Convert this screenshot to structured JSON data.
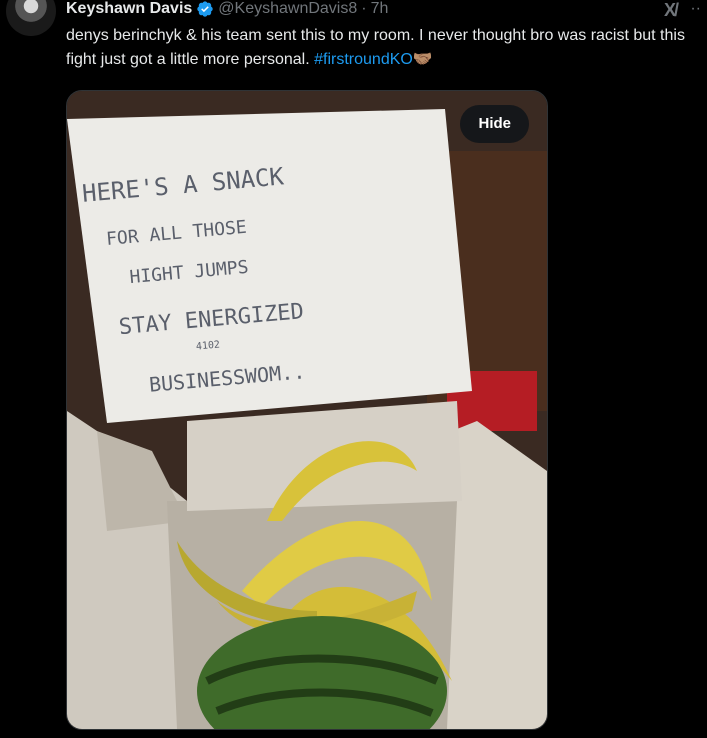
{
  "tweet": {
    "author_name": "Keyshawn Davis",
    "handle": "@KeyshawnDavis8",
    "separator": "·",
    "time": "7h",
    "text_main": "denys berinchyk & his team sent this to my room. I never thought bro was racist but this fight just got a little more personal. ",
    "hashtag": "#firstroundKO",
    "emoji": "🤝🏽"
  },
  "media": {
    "hide_label": "Hide",
    "note_lines": [
      "HERE'S A SNACK",
      "FOR ALL THOSE",
      "HIGHT JUMPS",
      "STAY ENERGIZED",
      "4102",
      "BUSINESSWOM.."
    ]
  },
  "icons": {
    "verified": "verified-badge-icon",
    "grok": "grok-icon",
    "more": "more-icon"
  },
  "colors": {
    "background": "#000000",
    "text": "#e7e9ea",
    "muted": "#71767b",
    "link": "#1d9bf0"
  }
}
